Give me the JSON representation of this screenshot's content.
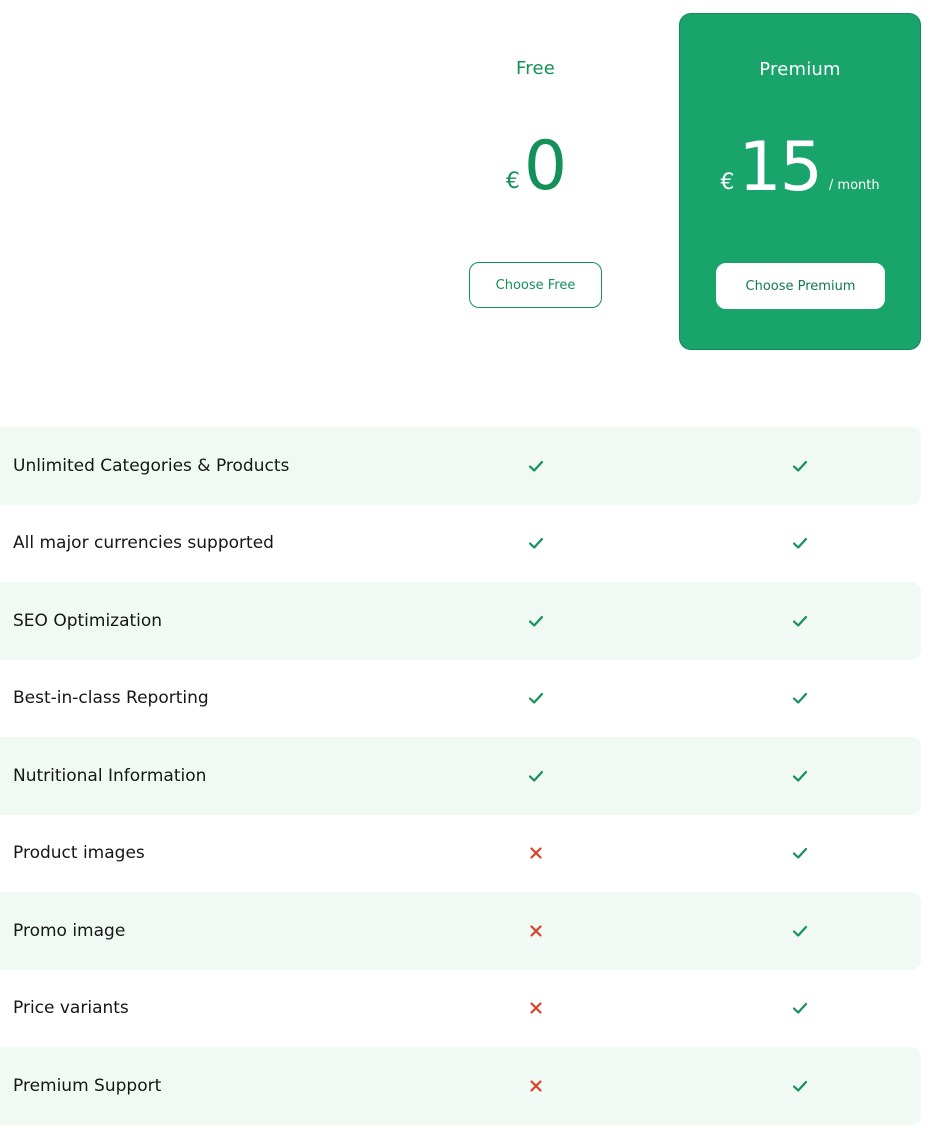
{
  "plans": {
    "free": {
      "name": "Free",
      "currency": "€",
      "amount": "0",
      "button_label": "Choose Free"
    },
    "premium": {
      "name": "Premium",
      "currency": "€",
      "amount": "15",
      "period": "/ month",
      "button_label": "Choose Premium"
    }
  },
  "colors": {
    "brand_green": "#18a46a",
    "check_green": "#139158",
    "cross_red": "#d9412b",
    "row_shade": "#f1f9f4"
  },
  "icons": {
    "included": "check-icon",
    "excluded": "cross-icon"
  },
  "features": [
    {
      "label": "Unlimited Categories & Products",
      "free": true,
      "premium": true
    },
    {
      "label": "All major currencies supported",
      "free": true,
      "premium": true
    },
    {
      "label": "SEO Optimization",
      "free": true,
      "premium": true
    },
    {
      "label": "Best-in-class Reporting",
      "free": true,
      "premium": true
    },
    {
      "label": "Nutritional Information",
      "free": true,
      "premium": true
    },
    {
      "label": "Product images",
      "free": false,
      "premium": true
    },
    {
      "label": "Promo image",
      "free": false,
      "premium": true
    },
    {
      "label": "Price variants",
      "free": false,
      "premium": true
    },
    {
      "label": "Premium Support",
      "free": false,
      "premium": true
    }
  ]
}
